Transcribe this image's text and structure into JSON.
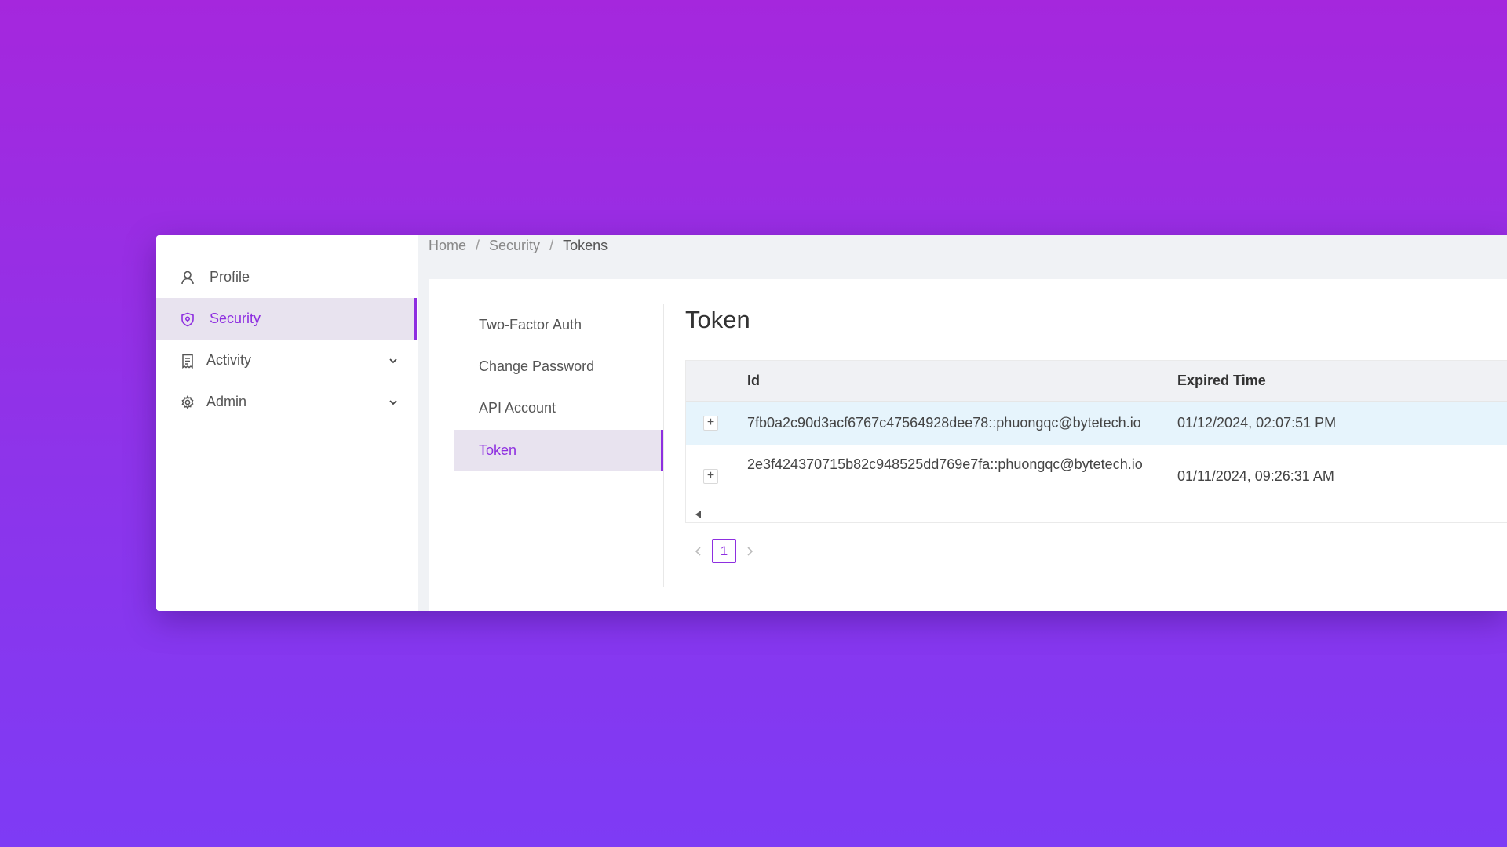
{
  "colors": {
    "accent": "#8e2fe0",
    "active_bg": "#e8e3ef",
    "row_highlight": "#e6f4fc",
    "background_top": "#a527dd",
    "background_bottom": "#7e3bf5"
  },
  "sidebar": {
    "items": [
      {
        "label": "Profile",
        "icon": "user-icon"
      },
      {
        "label": "Security",
        "icon": "shield-icon",
        "active": true
      },
      {
        "label": "Activity",
        "icon": "activity-log-icon",
        "expandable": true
      },
      {
        "label": "Admin",
        "icon": "gear-icon",
        "expandable": true
      }
    ]
  },
  "breadcrumb": {
    "items": [
      "Home",
      "Security",
      "Tokens"
    ],
    "separator": "/"
  },
  "subnav": {
    "items": [
      {
        "label": "Two-Factor Auth"
      },
      {
        "label": "Change Password"
      },
      {
        "label": "API Account"
      },
      {
        "label": "Token",
        "active": true
      }
    ]
  },
  "page": {
    "title": "Token"
  },
  "table": {
    "columns": [
      "Id",
      "Expired Time"
    ],
    "expand_symbol": "+",
    "rows": [
      {
        "id": "7fb0a2c90d3acf6767c47564928dee78::phuongqc@bytetech.io",
        "expired": "01/12/2024, 02:07:51 PM"
      },
      {
        "id": "2e3f424370715b82c948525dd769e7fa::phuongqc@bytetech.io",
        "expired": "01/11/2024, 09:26:31 AM"
      }
    ]
  },
  "pagination": {
    "current_page": "1"
  }
}
